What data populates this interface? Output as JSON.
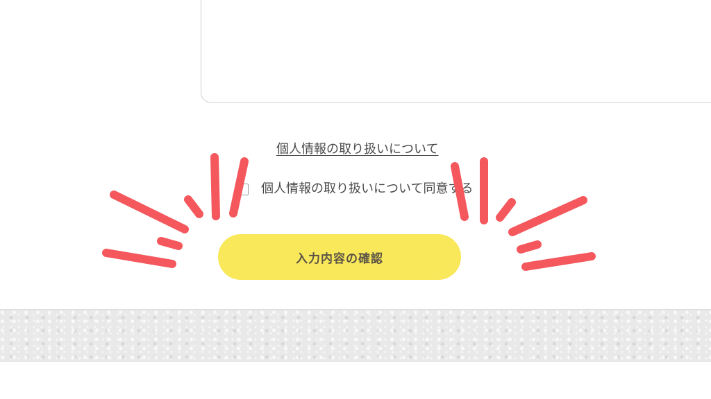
{
  "form": {
    "privacy_link_label": "個人情報の取り扱いについて",
    "agree_label": "個人情報の取り扱いについて同意する",
    "agree_checked": false,
    "submit_label": "入力内容の確認"
  },
  "colors": {
    "button_background": "#f9e85a",
    "burst_lines": "#f4575c",
    "text": "#4a4a4a"
  }
}
